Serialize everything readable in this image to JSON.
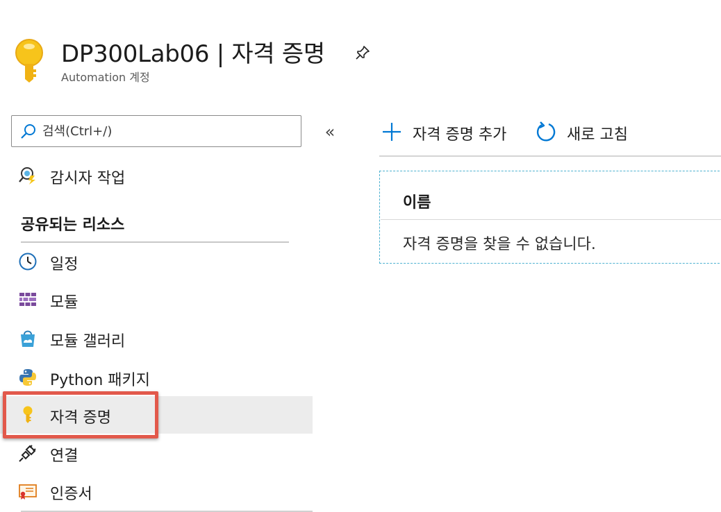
{
  "header": {
    "title": "DP300Lab06 | 자격 증명",
    "subtitle": "Automation 계정"
  },
  "search": {
    "placeholder": "검색(Ctrl+/)"
  },
  "sidebar": {
    "collapse_glyph": "«",
    "top_items": [
      {
        "label": "감시자 작업",
        "icon": "watcher-icon"
      }
    ],
    "section_title": "공유되는 리소스",
    "items": [
      {
        "label": "일정",
        "icon": "clock-icon"
      },
      {
        "label": "모듈",
        "icon": "modules-icon"
      },
      {
        "label": "모듈 갤러리",
        "icon": "gallery-icon"
      },
      {
        "label": "Python 패키지",
        "icon": "python-icon"
      },
      {
        "label": "자격 증명",
        "icon": "key-icon",
        "selected": true
      },
      {
        "label": "연결",
        "icon": "plug-icon"
      },
      {
        "label": "인증서",
        "icon": "certificate-icon"
      }
    ]
  },
  "toolbar": {
    "add_label": "자격 증명 추가",
    "refresh_label": "새로 고침"
  },
  "grid": {
    "columns": [
      "이름"
    ],
    "empty_message": "자격 증명을 찾을 수 없습니다."
  },
  "colors": {
    "accent": "#0078d4",
    "key_gold": "#f5c518",
    "highlight_border": "#e2594b",
    "selected_bg": "#ececec"
  }
}
